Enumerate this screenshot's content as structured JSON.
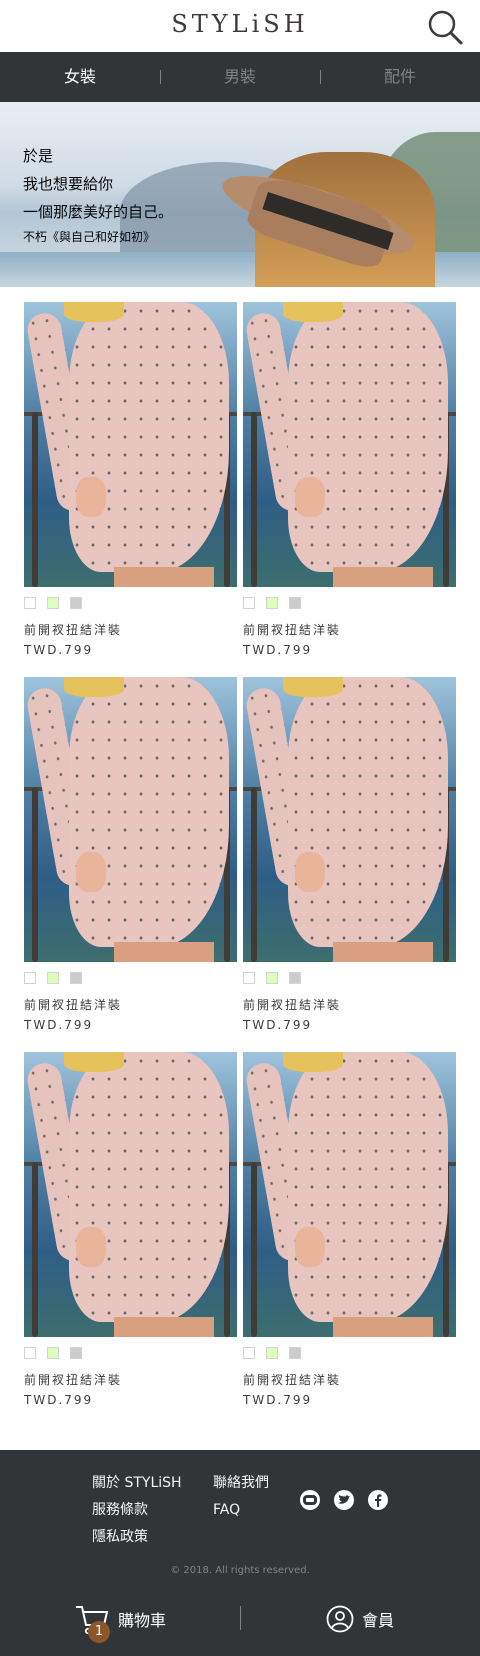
{
  "header": {
    "logo": "STYLiSH",
    "search_icon": "search-icon"
  },
  "nav": {
    "items": [
      {
        "label": "女裝",
        "active": true
      },
      {
        "label": "男裝",
        "active": false
      },
      {
        "label": "配件",
        "active": false
      }
    ]
  },
  "hero": {
    "lines": [
      "於是",
      "我也想要給你",
      "一個那麼美好的自己。"
    ],
    "subtitle": "不朽《與自己和好如初》"
  },
  "products": [
    {
      "name": "前開衩扭結洋裝",
      "price": "TWD.799",
      "colors": [
        "#FFFFFF",
        "#DDFFBB",
        "#CCCCCC"
      ]
    },
    {
      "name": "前開衩扭結洋裝",
      "price": "TWD.799",
      "colors": [
        "#FFFFFF",
        "#DDFFBB",
        "#CCCCCC"
      ]
    },
    {
      "name": "前開衩扭結洋裝",
      "price": "TWD.799",
      "colors": [
        "#FFFFFF",
        "#DDFFBB",
        "#CCCCCC"
      ]
    },
    {
      "name": "前開衩扭結洋裝",
      "price": "TWD.799",
      "colors": [
        "#FFFFFF",
        "#DDFFBB",
        "#CCCCCC"
      ]
    },
    {
      "name": "前開衩扭結洋裝",
      "price": "TWD.799",
      "colors": [
        "#FFFFFF",
        "#DDFFBB",
        "#CCCCCC"
      ]
    },
    {
      "name": "前開衩扭結洋裝",
      "price": "TWD.799",
      "colors": [
        "#FFFFFF",
        "#DDFFBB",
        "#CCCCCC"
      ]
    }
  ],
  "footer": {
    "links": [
      "關於 STYLiSH",
      "聯絡我們",
      "服務條款",
      "FAQ",
      "隱私政策"
    ],
    "social_icons": [
      "line-icon",
      "twitter-icon",
      "facebook-icon"
    ],
    "copyright": "© 2018. All rights reserved."
  },
  "bottom_bar": {
    "cart_label": "購物車",
    "cart_count": "1",
    "member_label": "會員"
  },
  "colors": {
    "dark_bg": "#313538",
    "accent_badge": "#8B572A",
    "text": "#3F3A3A"
  }
}
